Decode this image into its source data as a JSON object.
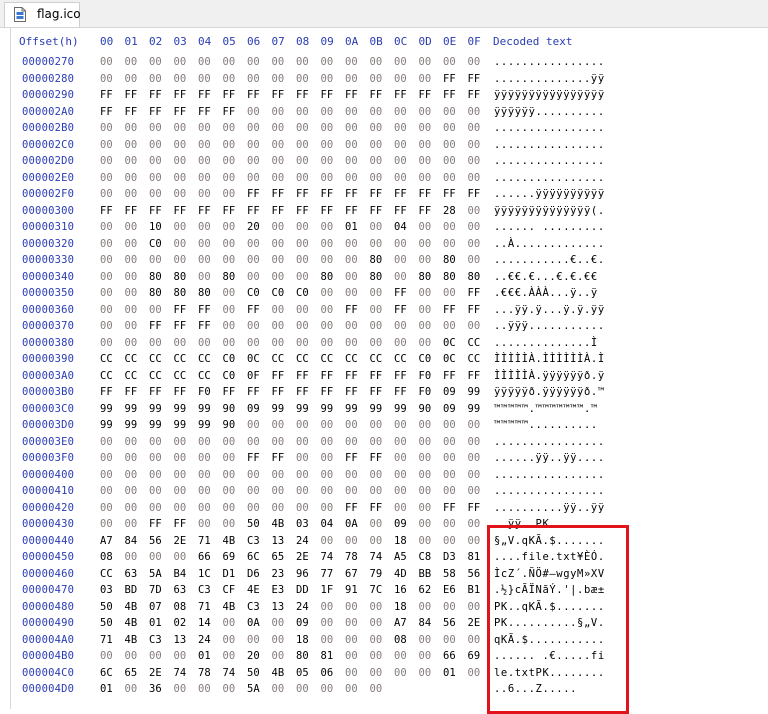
{
  "tab": {
    "label": "flag.ico",
    "icon": "ico-file-icon"
  },
  "header": {
    "offset_label": "Offset(h)",
    "columns": [
      "00",
      "01",
      "02",
      "03",
      "04",
      "05",
      "06",
      "07",
      "08",
      "09",
      "0A",
      "0B",
      "0C",
      "0D",
      "0E",
      "0F"
    ],
    "decoded_label": "Decoded text"
  },
  "colors": {
    "address": "#2a3cb4",
    "zero_byte": "#867b7b",
    "byte": "#000000",
    "highlight": "#e2131b"
  },
  "rows": [
    {
      "offset": "00000270",
      "bytes": [
        "00",
        "00",
        "00",
        "00",
        "00",
        "00",
        "00",
        "00",
        "00",
        "00",
        "00",
        "00",
        "00",
        "00",
        "00",
        "00"
      ],
      "decoded": "................"
    },
    {
      "offset": "00000280",
      "bytes": [
        "00",
        "00",
        "00",
        "00",
        "00",
        "00",
        "00",
        "00",
        "00",
        "00",
        "00",
        "00",
        "00",
        "00",
        "FF",
        "FF"
      ],
      "decoded": "..............ÿÿ"
    },
    {
      "offset": "00000290",
      "bytes": [
        "FF",
        "FF",
        "FF",
        "FF",
        "FF",
        "FF",
        "FF",
        "FF",
        "FF",
        "FF",
        "FF",
        "FF",
        "FF",
        "FF",
        "FF",
        "FF"
      ],
      "decoded": "ÿÿÿÿÿÿÿÿÿÿÿÿÿÿÿÿ"
    },
    {
      "offset": "000002A0",
      "bytes": [
        "FF",
        "FF",
        "FF",
        "FF",
        "FF",
        "FF",
        "00",
        "00",
        "00",
        "00",
        "00",
        "00",
        "00",
        "00",
        "00",
        "00"
      ],
      "decoded": "ÿÿÿÿÿÿ.........."
    },
    {
      "offset": "000002B0",
      "bytes": [
        "00",
        "00",
        "00",
        "00",
        "00",
        "00",
        "00",
        "00",
        "00",
        "00",
        "00",
        "00",
        "00",
        "00",
        "00",
        "00"
      ],
      "decoded": "................"
    },
    {
      "offset": "000002C0",
      "bytes": [
        "00",
        "00",
        "00",
        "00",
        "00",
        "00",
        "00",
        "00",
        "00",
        "00",
        "00",
        "00",
        "00",
        "00",
        "00",
        "00"
      ],
      "decoded": "................"
    },
    {
      "offset": "000002D0",
      "bytes": [
        "00",
        "00",
        "00",
        "00",
        "00",
        "00",
        "00",
        "00",
        "00",
        "00",
        "00",
        "00",
        "00",
        "00",
        "00",
        "00"
      ],
      "decoded": "................"
    },
    {
      "offset": "000002E0",
      "bytes": [
        "00",
        "00",
        "00",
        "00",
        "00",
        "00",
        "00",
        "00",
        "00",
        "00",
        "00",
        "00",
        "00",
        "00",
        "00",
        "00"
      ],
      "decoded": "................"
    },
    {
      "offset": "000002F0",
      "bytes": [
        "00",
        "00",
        "00",
        "00",
        "00",
        "00",
        "FF",
        "FF",
        "FF",
        "FF",
        "FF",
        "FF",
        "FF",
        "FF",
        "FF",
        "FF"
      ],
      "decoded": "......ÿÿÿÿÿÿÿÿÿÿ"
    },
    {
      "offset": "00000300",
      "bytes": [
        "FF",
        "FF",
        "FF",
        "FF",
        "FF",
        "FF",
        "FF",
        "FF",
        "FF",
        "FF",
        "FF",
        "FF",
        "FF",
        "FF",
        "28",
        "00"
      ],
      "decoded": "ÿÿÿÿÿÿÿÿÿÿÿÿÿÿ(."
    },
    {
      "offset": "00000310",
      "bytes": [
        "00",
        "00",
        "10",
        "00",
        "00",
        "00",
        "20",
        "00",
        "00",
        "00",
        "01",
        "00",
        "04",
        "00",
        "00",
        "00"
      ],
      "decoded": "...... ........."
    },
    {
      "offset": "00000320",
      "bytes": [
        "00",
        "00",
        "C0",
        "00",
        "00",
        "00",
        "00",
        "00",
        "00",
        "00",
        "00",
        "00",
        "00",
        "00",
        "00",
        "00"
      ],
      "decoded": "..À............."
    },
    {
      "offset": "00000330",
      "bytes": [
        "00",
        "00",
        "00",
        "00",
        "00",
        "00",
        "00",
        "00",
        "00",
        "00",
        "00",
        "80",
        "00",
        "00",
        "80",
        "00"
      ],
      "decoded": "...........€..€."
    },
    {
      "offset": "00000340",
      "bytes": [
        "00",
        "00",
        "80",
        "80",
        "00",
        "80",
        "00",
        "00",
        "00",
        "80",
        "00",
        "80",
        "00",
        "80",
        "80",
        "80"
      ],
      "decoded": "..€€.€...€.€.€€"
    },
    {
      "offset": "00000350",
      "bytes": [
        "00",
        "00",
        "80",
        "80",
        "80",
        "00",
        "C0",
        "C0",
        "C0",
        "00",
        "00",
        "00",
        "FF",
        "00",
        "00",
        "FF"
      ],
      "decoded": ".€€€.ÀÀÀ...ÿ..ÿ"
    },
    {
      "offset": "00000360",
      "bytes": [
        "00",
        "00",
        "00",
        "FF",
        "FF",
        "00",
        "FF",
        "00",
        "00",
        "00",
        "FF",
        "00",
        "FF",
        "00",
        "FF",
        "FF"
      ],
      "decoded": "...ÿÿ.ÿ...ÿ.ÿ.ÿÿ"
    },
    {
      "offset": "00000370",
      "bytes": [
        "00",
        "00",
        "FF",
        "FF",
        "FF",
        "00",
        "00",
        "00",
        "00",
        "00",
        "00",
        "00",
        "00",
        "00",
        "00",
        "00"
      ],
      "decoded": "..ÿÿÿ..........."
    },
    {
      "offset": "00000380",
      "bytes": [
        "00",
        "00",
        "00",
        "00",
        "00",
        "00",
        "00",
        "00",
        "00",
        "00",
        "00",
        "00",
        "00",
        "00",
        "0C",
        "CC"
      ],
      "decoded": "..............Ì"
    },
    {
      "offset": "00000390",
      "bytes": [
        "CC",
        "CC",
        "CC",
        "CC",
        "CC",
        "C0",
        "0C",
        "CC",
        "CC",
        "CC",
        "CC",
        "CC",
        "CC",
        "C0",
        "0C",
        "CC"
      ],
      "decoded": "ÌÌÌÌÌÀ.ÌÌÌÌÌÌÀ.Ì"
    },
    {
      "offset": "000003A0",
      "bytes": [
        "CC",
        "CC",
        "CC",
        "CC",
        "CC",
        "C0",
        "0F",
        "FF",
        "FF",
        "FF",
        "FF",
        "FF",
        "FF",
        "F0",
        "FF",
        "FF"
      ],
      "decoded": "ÌÌÌÌÌÀ.ÿÿÿÿÿÿð.ÿ"
    },
    {
      "offset": "000003B0",
      "bytes": [
        "FF",
        "FF",
        "FF",
        "FF",
        "F0",
        "FF",
        "FF",
        "FF",
        "FF",
        "FF",
        "FF",
        "FF",
        "FF",
        "F0",
        "09",
        "99"
      ],
      "decoded": "ÿÿÿÿÿð.ÿÿÿÿÿÿð.™"
    },
    {
      "offset": "000003C0",
      "bytes": [
        "99",
        "99",
        "99",
        "99",
        "99",
        "90",
        "09",
        "99",
        "99",
        "99",
        "99",
        "99",
        "99",
        "90",
        "09",
        "99"
      ],
      "decoded": "™™™™™.™™™™™™™.™"
    },
    {
      "offset": "000003D0",
      "bytes": [
        "99",
        "99",
        "99",
        "99",
        "99",
        "90",
        "00",
        "00",
        "00",
        "00",
        "00",
        "00",
        "00",
        "00",
        "00",
        "00"
      ],
      "decoded": "™™™™™.........."
    },
    {
      "offset": "000003E0",
      "bytes": [
        "00",
        "00",
        "00",
        "00",
        "00",
        "00",
        "00",
        "00",
        "00",
        "00",
        "00",
        "00",
        "00",
        "00",
        "00",
        "00"
      ],
      "decoded": "................"
    },
    {
      "offset": "000003F0",
      "bytes": [
        "00",
        "00",
        "00",
        "00",
        "00",
        "00",
        "FF",
        "FF",
        "00",
        "00",
        "FF",
        "FF",
        "00",
        "00",
        "00",
        "00"
      ],
      "decoded": "......ÿÿ..ÿÿ...."
    },
    {
      "offset": "00000400",
      "bytes": [
        "00",
        "00",
        "00",
        "00",
        "00",
        "00",
        "00",
        "00",
        "00",
        "00",
        "00",
        "00",
        "00",
        "00",
        "00",
        "00"
      ],
      "decoded": "................"
    },
    {
      "offset": "00000410",
      "bytes": [
        "00",
        "00",
        "00",
        "00",
        "00",
        "00",
        "00",
        "00",
        "00",
        "00",
        "00",
        "00",
        "00",
        "00",
        "00",
        "00"
      ],
      "decoded": "................"
    },
    {
      "offset": "00000420",
      "bytes": [
        "00",
        "00",
        "00",
        "00",
        "00",
        "00",
        "00",
        "00",
        "00",
        "00",
        "FF",
        "FF",
        "00",
        "00",
        "FF",
        "FF"
      ],
      "decoded": "..........ÿÿ..ÿÿ"
    },
    {
      "offset": "00000430",
      "bytes": [
        "00",
        "00",
        "FF",
        "FF",
        "00",
        "00",
        "50",
        "4B",
        "03",
        "04",
        "0A",
        "00",
        "09",
        "00",
        "00",
        "00"
      ],
      "decoded": "..ÿÿ..PK........"
    },
    {
      "offset": "00000440",
      "bytes": [
        "A7",
        "84",
        "56",
        "2E",
        "71",
        "4B",
        "C3",
        "13",
        "24",
        "00",
        "00",
        "00",
        "18",
        "00",
        "00",
        "00"
      ],
      "decoded": "§„V.qKÃ.$......."
    },
    {
      "offset": "00000450",
      "bytes": [
        "08",
        "00",
        "00",
        "00",
        "66",
        "69",
        "6C",
        "65",
        "2E",
        "74",
        "78",
        "74",
        "A5",
        "C8",
        "D3",
        "81"
      ],
      "decoded": "....file.txt¥ÈÓ."
    },
    {
      "offset": "00000460",
      "bytes": [
        "CC",
        "63",
        "5A",
        "B4",
        "1C",
        "D1",
        "D6",
        "23",
        "96",
        "77",
        "67",
        "79",
        "4D",
        "BB",
        "58",
        "56"
      ],
      "decoded": "ÌcZ´.ÑÖ#–wgyM»XV"
    },
    {
      "offset": "00000470",
      "bytes": [
        "03",
        "BD",
        "7D",
        "63",
        "C3",
        "CF",
        "4E",
        "E3",
        "DD",
        "1F",
        "91",
        "7C",
        "16",
        "62",
        "E6",
        "B1"
      ],
      "decoded": ".½}cÃÏNãÝ.'|.bæ±"
    },
    {
      "offset": "00000480",
      "bytes": [
        "50",
        "4B",
        "07",
        "08",
        "71",
        "4B",
        "C3",
        "13",
        "24",
        "00",
        "00",
        "00",
        "18",
        "00",
        "00",
        "00"
      ],
      "decoded": "PK..qKÃ.$......."
    },
    {
      "offset": "00000490",
      "bytes": [
        "50",
        "4B",
        "01",
        "02",
        "14",
        "00",
        "0A",
        "00",
        "09",
        "00",
        "00",
        "00",
        "A7",
        "84",
        "56",
        "2E"
      ],
      "decoded": "PK..........§„V."
    },
    {
      "offset": "000004A0",
      "bytes": [
        "71",
        "4B",
        "C3",
        "13",
        "24",
        "00",
        "00",
        "00",
        "18",
        "00",
        "00",
        "00",
        "08",
        "00",
        "00",
        "00"
      ],
      "decoded": "qKÃ.$..........."
    },
    {
      "offset": "000004B0",
      "bytes": [
        "00",
        "00",
        "00",
        "00",
        "01",
        "00",
        "20",
        "00",
        "80",
        "81",
        "00",
        "00",
        "00",
        "00",
        "66",
        "69"
      ],
      "decoded": "...... .€.....fi"
    },
    {
      "offset": "000004C0",
      "bytes": [
        "6C",
        "65",
        "2E",
        "74",
        "78",
        "74",
        "50",
        "4B",
        "05",
        "06",
        "00",
        "00",
        "00",
        "00",
        "01",
        "00"
      ],
      "decoded": "le.txtPK........"
    },
    {
      "offset": "000004D0",
      "bytes": [
        "01",
        "00",
        "36",
        "00",
        "00",
        "00",
        "5A",
        "00",
        "00",
        "00",
        "00",
        "00"
      ],
      "decoded": "..6...Z....."
    }
  ]
}
